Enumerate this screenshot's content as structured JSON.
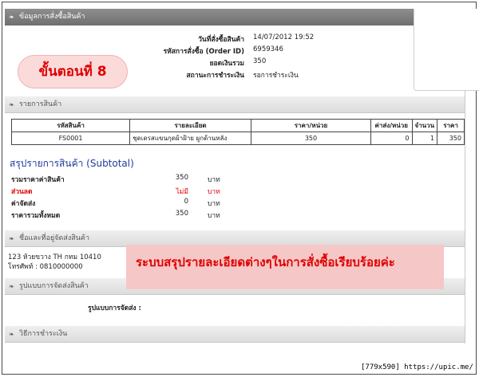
{
  "order_info": {
    "title": "ข้อมูลการสั่งซื้อสินค้า",
    "fields": [
      {
        "label": "วันที่สั่งซื้อสินค้า",
        "value": "14/07/2012 19:52"
      },
      {
        "label": "รหัสการสั่งซื้อ (Order ID)",
        "value": "6959346"
      },
      {
        "label": "ยอดเงินรวม",
        "value": "350"
      },
      {
        "label": "สถานะการชำระเงิน",
        "value": "รอการชำระเงิน"
      }
    ],
    "step_badge": "ขั้นตอนที่  8"
  },
  "items": {
    "title": "รายการสินค้า",
    "columns": [
      "รหัสสินค้า",
      "รายละเอียด",
      "ราคา/หน่วย",
      "ค่าส่ง/หน่วย",
      "จำนวน",
      "ราคา"
    ],
    "rows": [
      [
        "FS0001",
        "ชุดเดรสแขนกุดผ้าฝ้าย ผูกด้านหลัง",
        "350",
        "0",
        "1",
        "350"
      ]
    ]
  },
  "subtotal": {
    "title": "สรุปรายการสินค้า (Subtotal)",
    "rows": [
      {
        "label": "รวมราคาค่าสินค้า",
        "value": "350",
        "unit": "บาท"
      },
      {
        "label": "ส่วนลด",
        "value": "ไม่มี",
        "unit": "บาท"
      },
      {
        "label": "ค่าจัดส่ง",
        "value": "0",
        "unit": "บาท"
      },
      {
        "label": "ราคารวมทั้งหมด",
        "value": "350",
        "unit": "บาท"
      }
    ]
  },
  "shipping_address": {
    "title": "ชื่อและที่อยู่จัดส่งสินค้า",
    "address": "123 ห้วยขวาง TH กทม 10410",
    "phone": "โทรศัพท์ : 0810000000"
  },
  "note": "ระบบสรุปรายละเอียดต่างๆในการสั่งซื้อเรียบร้อยค่ะ",
  "shipping_method": {
    "title": "รูปแบบการจัดส่งสินค้า",
    "label": "รูปแบบการจัดส่ง :"
  },
  "payment_method": {
    "title": "วิธีการชำระเงิน"
  },
  "watermark": "[779x590] https://upic.me/",
  "colors": {
    "accent_red": "#e00000",
    "subtotal_blue": "#1f3c9a",
    "badge_pink": "#fbdada",
    "note_pink": "#f6c7c7"
  }
}
